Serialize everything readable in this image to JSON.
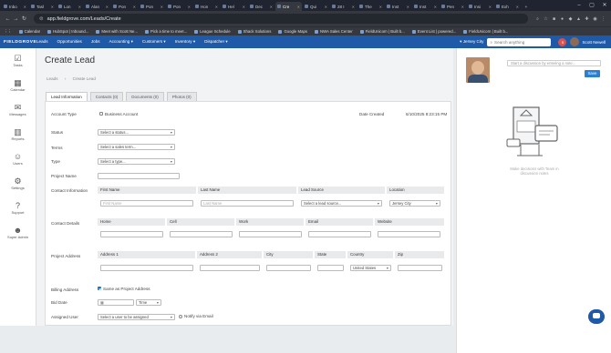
{
  "browser": {
    "tabs": [
      "Inbo",
      "Tasl",
      "Lon",
      "Alan",
      "Pon",
      "Pon",
      "Pon",
      "Hon",
      "Hel",
      "Dec",
      "Cre",
      "Qui",
      "28 I",
      "The",
      "Inst",
      "Inst",
      "Pen",
      "Insi",
      "Exh"
    ],
    "active_tab_index": 10,
    "url": "app.fieldgrove.com/Leads/Create",
    "bookmarks": [
      "Calendar",
      "HubSpot | Inbound...",
      "Meet with Scott Ne...",
      "Pick a time to meet...",
      "League Schedule",
      "Shack Solutions",
      "Google Maps",
      "NWA Sales Center",
      "FieldUnicorn | Built b...",
      "Event List | powered...",
      "FieldUnicorn | Built b..."
    ],
    "all_bookmarks": "All Bookmarks"
  },
  "appnav": {
    "logo": "FIELDGROVE",
    "items": [
      "Leads",
      "Opportunities",
      "Jobs",
      "Accounting ▾",
      "Customers ▾",
      "Inventory ▾",
      "Dispatcher ▾"
    ],
    "location": "▾ Jersey City",
    "search_placeholder": "Search anything",
    "notif_count": "5",
    "user": "Scott Newell"
  },
  "sidebar": [
    {
      "icon": "☑",
      "label": "Tasks"
    },
    {
      "icon": "▦",
      "label": "Calendar"
    },
    {
      "icon": "✉",
      "label": "Messages"
    },
    {
      "icon": "▥",
      "label": "Reports"
    },
    {
      "icon": "☺",
      "label": "Users"
    },
    {
      "icon": "⚙",
      "label": "Settings"
    },
    {
      "icon": "?",
      "label": "Support"
    },
    {
      "icon": "☻",
      "label": "Super Admin"
    }
  ],
  "page": {
    "title": "Create Lead",
    "breadcrumb": [
      "Leads",
      "›",
      "Create Lead"
    ],
    "tabs": [
      "Lead Information",
      "Contacts (0)",
      "Documents (0)",
      "Photos (0)"
    ]
  },
  "form": {
    "account_type_label": "Account Type",
    "business_account": "Business Account",
    "date_created_label": "Date Created",
    "date_created": "6/10/2025 8:23:15 PM",
    "status_label": "Status",
    "status_value": "Select a status...",
    "terms_label": "Terms",
    "terms_value": "Select a sales term...",
    "type_label": "Type",
    "type_value": "Select a type...",
    "project_name_label": "Project Name",
    "contact_info_label": "Contact Information",
    "contact_headers": [
      "First Name",
      "Last Name",
      "Lead Source",
      "Location"
    ],
    "first_name_ph": "First Name",
    "last_name_ph": "Last Name",
    "lead_source_value": "Select a lead source...",
    "location_value": "Jersey City",
    "contact_details_label": "Contact Details",
    "detail_headers": [
      "Home",
      "Cell",
      "Work",
      "Email",
      "Website"
    ],
    "project_address_label": "Project Address",
    "address_headers": [
      "Address 1",
      "Address 2",
      "City",
      "State",
      "Country",
      "Zip"
    ],
    "country_value": "United States",
    "billing_label": "Billing Address",
    "same_as_project": "Same as Project Address",
    "bid_date_label": "Bid Date",
    "time_value": "Time",
    "assigned_label": "Assigned User",
    "assigned_value": "Select a user to be assigned",
    "notify_email": "Notify via Email"
  },
  "right_panel": {
    "discussion_placeholder": "Start a discussion by entering a note...",
    "save": "Save",
    "empty_text": "Make decisions with Team in discussion notes"
  },
  "colors": {
    "nav": "#1e5aa8",
    "accent": "#2a7fd4"
  }
}
